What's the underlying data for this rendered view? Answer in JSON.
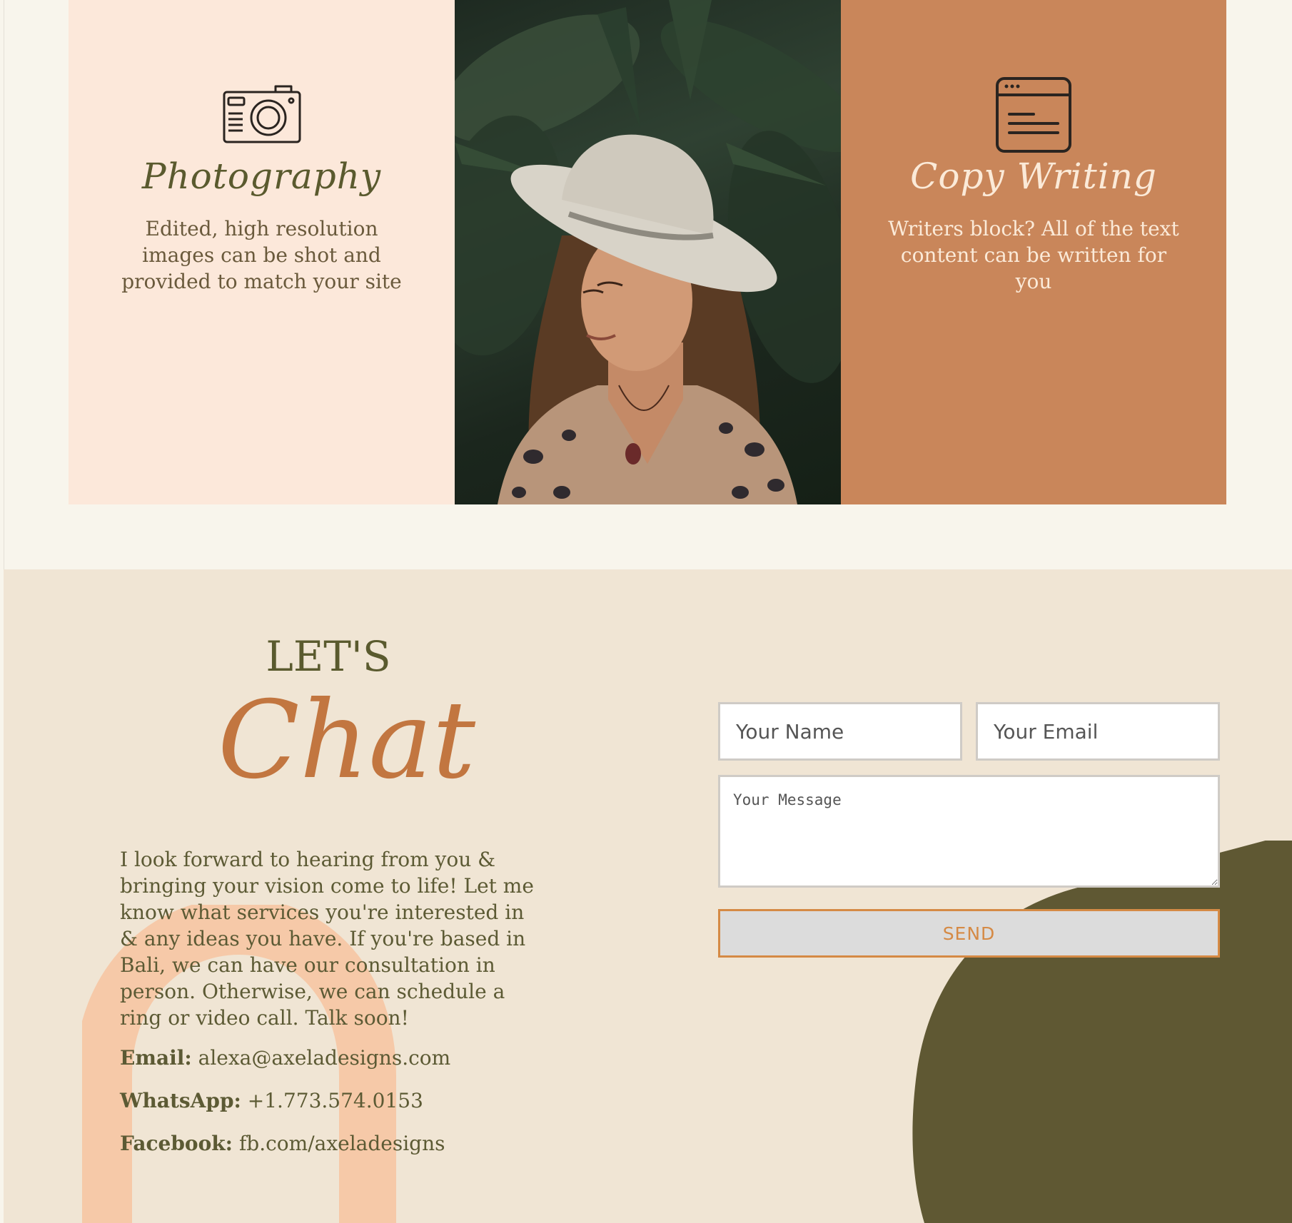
{
  "services": [
    {
      "icon": "camera-icon",
      "title": "Photography",
      "description": "Edited, high resolution images can be shot and provided to match your site"
    },
    {
      "icon": "portrait-photo",
      "image_alt": "Woman in a white hat among tropical leaves"
    },
    {
      "icon": "browser-window-icon",
      "title": "Copy Writing",
      "description": "Writers block? All of the text content can be written for you"
    }
  ],
  "contact": {
    "heading_top": "LET'S",
    "heading_script": "Chat",
    "intro": "I look forward to hearing from you & bringing your vision come to life! Let me know what services you're interested in & any ideas you have. If you're based in Bali, we can have our consultation in person. Otherwise, we can schedule a ring or video call. Talk soon!",
    "email_label": "Email:",
    "email_value": "alexa@axeladesigns.com",
    "whatsapp_label": "WhatsApp:",
    "whatsapp_value": "+1.773.574.0153",
    "facebook_label": "Facebook:",
    "facebook_value": "fb.com/axeladesigns"
  },
  "form": {
    "name_placeholder": "Your Name",
    "email_placeholder": "Your Email",
    "message_placeholder": "Your Message",
    "send_label": "SEND"
  },
  "colors": {
    "page_bg": "#f8f5ec",
    "photo_card_bg": "#fce8da",
    "copy_card_bg": "#c9865a",
    "contact_bg": "#f0e5d4",
    "olive": "#5a5a2e",
    "accent_orange": "#c27640",
    "arch_peach": "#f6c9a8"
  }
}
